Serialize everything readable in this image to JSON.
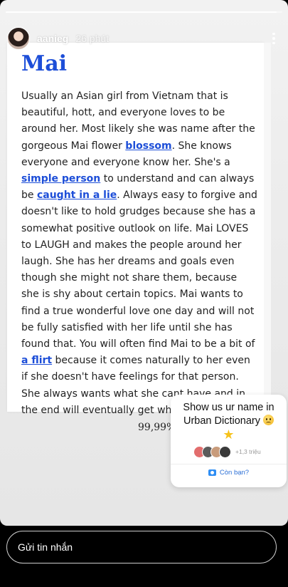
{
  "story": {
    "username": "aanieg",
    "time": "26 phút",
    "progress": 0.98
  },
  "definition": {
    "word": "Mai",
    "segments": [
      {
        "text": "Usually an Asian girl from Vietnam that is beautiful, hott, and everyone loves to be around her. Most likely she was name after the gorgeous Mai flower ",
        "link": false
      },
      {
        "text": "blossom",
        "link": true
      },
      {
        "text": ". She knows everyone and everyone know her. She's a ",
        "link": false
      },
      {
        "text": "simple person",
        "link": true
      },
      {
        "text": " to understand and can always be ",
        "link": false
      },
      {
        "text": "caught in a lie",
        "link": true
      },
      {
        "text": ". Always easy to forgive and doesn't like to hold grudges because she has a somewhat positive outlook on life. Mai LOVES to LAUGH and makes the people around her laugh. She has her dreams and goals even though she might not share them, because she is shy about certain topics. Mai wants to find a true wonderful love one day and will not be fully satisfied with her life until she has found that. You will often find Mai to be a bit of ",
        "link": false
      },
      {
        "text": "a flirt",
        "link": true
      },
      {
        "text": " because it comes naturally to her even if she doesn't have feelings for that person. She always wants what she cant have and in the end will eventually get what she wants.",
        "link": false
      }
    ]
  },
  "overlay_text": "99,99%",
  "sticker": {
    "title": "Show us ur name in Urban Dictionary",
    "emoji": "worried-smile-icon",
    "star": "★",
    "participant_colors": [
      "#e26d6d",
      "#5b5b5b",
      "#c89b7b",
      "#3a3a3a"
    ],
    "participant_count": "+1,3 triệu",
    "cta": "Còn bạn?"
  },
  "footer": {
    "placeholder": "Gửi tin nhắn"
  }
}
